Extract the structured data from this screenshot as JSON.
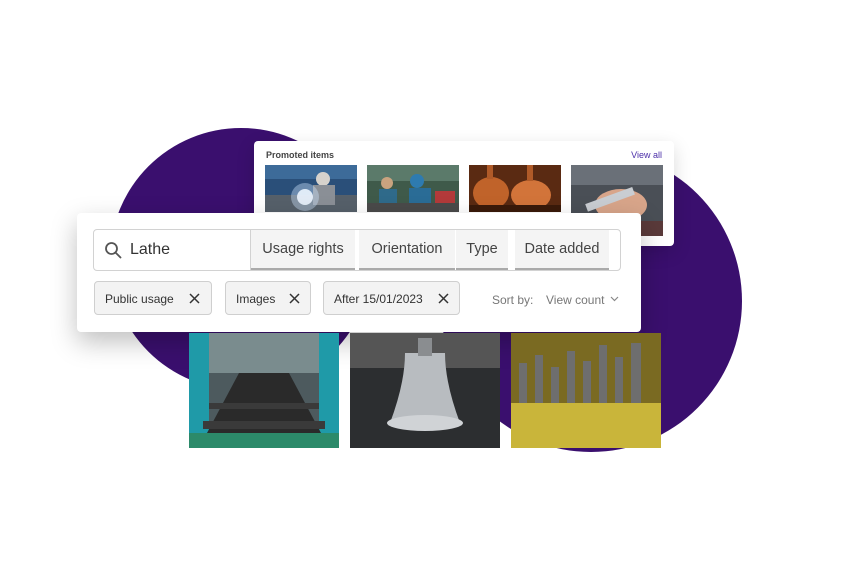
{
  "colors": {
    "accent": "#3a0f6e",
    "link": "#4b2ea8"
  },
  "promoted": {
    "title": "Promoted items",
    "view_all": "View all",
    "thumbs": [
      "welding-photo",
      "factory-workers-photo",
      "copper-stills-photo",
      "hand-tool-photo"
    ]
  },
  "search": {
    "value": "Lathe",
    "icon": "search-icon"
  },
  "filters": [
    "Usage rights",
    "Orientation",
    "Type",
    "Date added"
  ],
  "chips": [
    "Public usage",
    "Images",
    "After 15/01/2023"
  ],
  "sort": {
    "label": "Sort by:",
    "value": "View count"
  },
  "results": [
    "factory-conveyor-photo",
    "metal-bell-photo",
    "drill-bits-photo"
  ]
}
